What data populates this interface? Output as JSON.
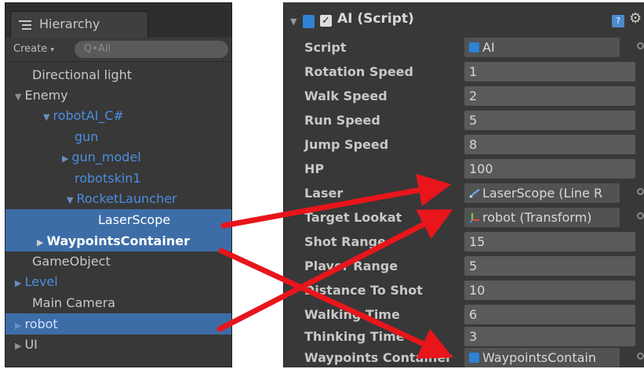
{
  "hierarchy": {
    "tab_label": "Hierarchy",
    "create_label": "Create",
    "search_placeholder": "Q•All",
    "items": [
      {
        "label": "Directional light"
      },
      {
        "label": "Enemy"
      },
      {
        "label": "robotAI_C#"
      },
      {
        "label": "gun"
      },
      {
        "label": "gun_model"
      },
      {
        "label": "robotskin1"
      },
      {
        "label": "RocketLauncher"
      },
      {
        "label": "LaserScope"
      },
      {
        "label": "WaypointsContainer"
      },
      {
        "label": "GameObject"
      },
      {
        "label": "Level"
      },
      {
        "label": "Main Camera"
      },
      {
        "label": "robot"
      },
      {
        "label": "UI"
      }
    ]
  },
  "inspector": {
    "component_title": "AI (Script)",
    "fields": [
      {
        "label": "Script",
        "value": "AI"
      },
      {
        "label": "Rotation Speed",
        "value": "1"
      },
      {
        "label": "Walk Speed",
        "value": "2"
      },
      {
        "label": "Run Speed",
        "value": "5"
      },
      {
        "label": "Jump Speed",
        "value": "8"
      },
      {
        "label": "HP",
        "value": "100"
      },
      {
        "label": "Laser",
        "value": "LaserScope (Line R"
      },
      {
        "label": "Target Lookat",
        "value": "robot (Transform)"
      },
      {
        "label": "Shot Range",
        "value": "15"
      },
      {
        "label": "Player Range",
        "value": "5"
      },
      {
        "label": "Distance To Shot",
        "value": "10"
      },
      {
        "label": "Walking Time",
        "value": "6"
      },
      {
        "label": "Thinking Time",
        "value": "3"
      },
      {
        "label": "Waypoints Container",
        "value": "WaypointsContain"
      }
    ]
  },
  "annotation": {
    "arrow_color": "#e8151b"
  }
}
